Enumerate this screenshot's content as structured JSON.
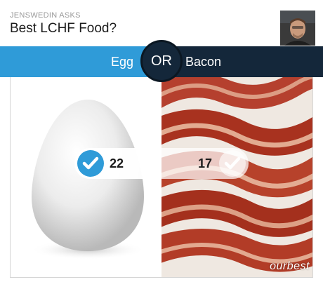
{
  "header": {
    "asker": "JENSWEDIN ASKS",
    "question": "Best LCHF Food?"
  },
  "poll": {
    "option_a": {
      "label": "Egg",
      "votes": "22",
      "selected": true,
      "image": "egg-photo"
    },
    "option_b": {
      "label": "Bacon",
      "votes": "17",
      "selected": false,
      "image": "bacon-photo"
    },
    "separator": "OR",
    "watermark": "ourbest"
  },
  "colors": {
    "accent": "#2f9bd8",
    "dark": "#14273a"
  }
}
